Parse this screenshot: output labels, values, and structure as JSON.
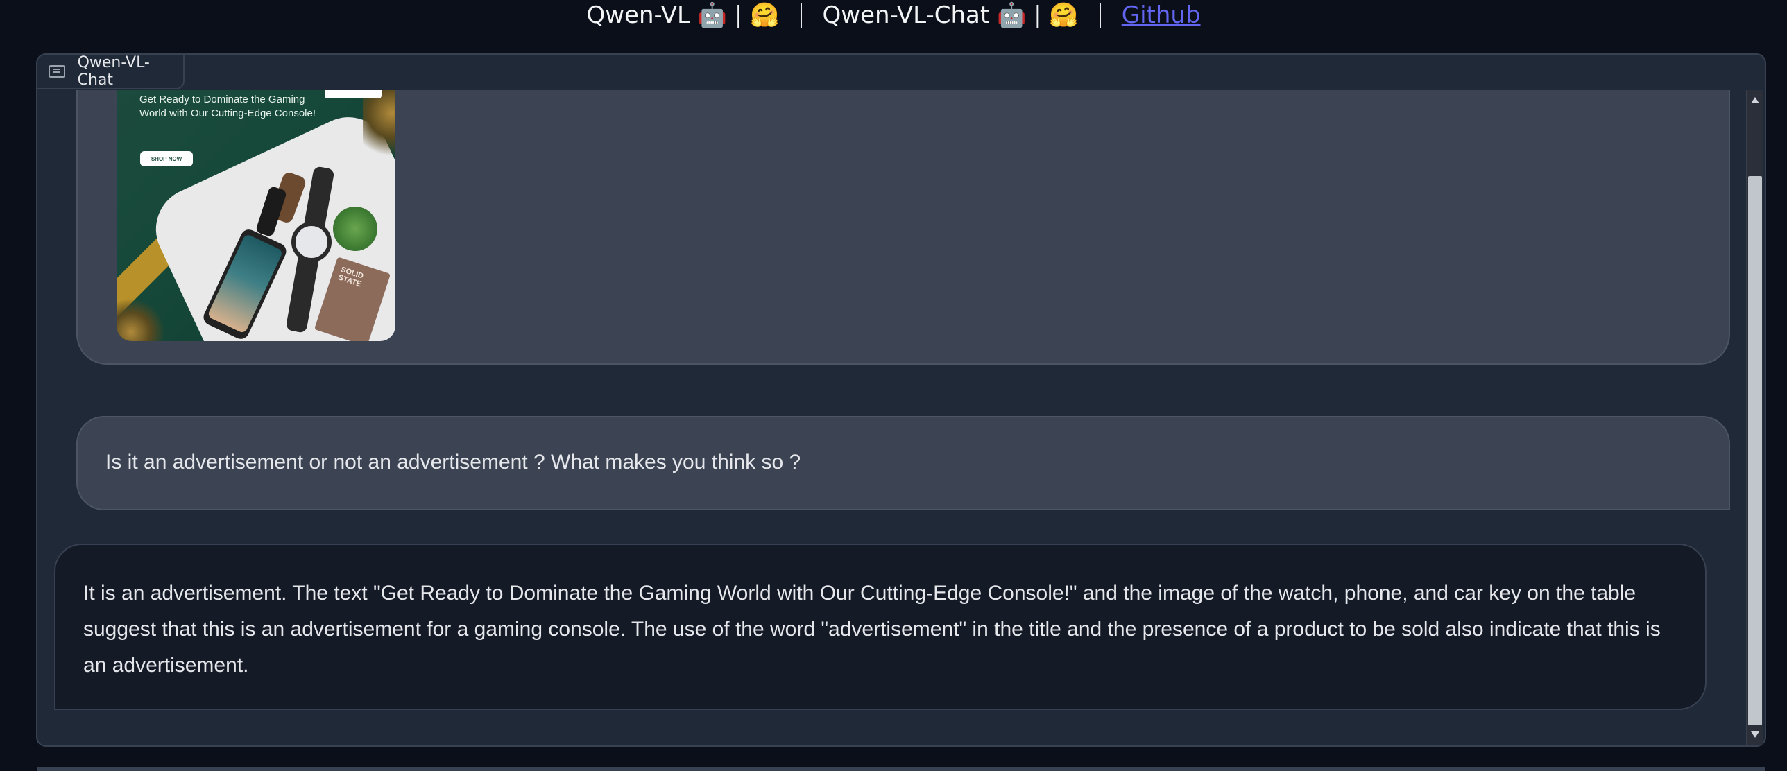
{
  "header": {
    "model_links": [
      {
        "label": "Qwen-VL 🤖 | 🤗"
      },
      {
        "label": "Qwen-VL-Chat 🤖 | 🤗"
      }
    ],
    "github_label": "Github"
  },
  "chat": {
    "label": "Qwen-VL-Chat",
    "image_message": {
      "headline": "Get Ready to Dominate the Gaming World with Our Cutting-Edge Console!",
      "button": "SHOP NOW",
      "book_title": "SOLID STATE"
    },
    "user_question": "Is it an advertisement or not an advertisement ? What makes you think so ?",
    "bot_answer": "It is an advertisement. The text \"Get Ready to Dominate the Gaming World with Our Cutting-Edge Console!\" and the image of the watch, phone, and car key on the table suggest that this is an advertisement for a gaming console. The use of the word \"advertisement\" in the title and the presence of a product to be sold also indicate that this is an advertisement."
  }
}
